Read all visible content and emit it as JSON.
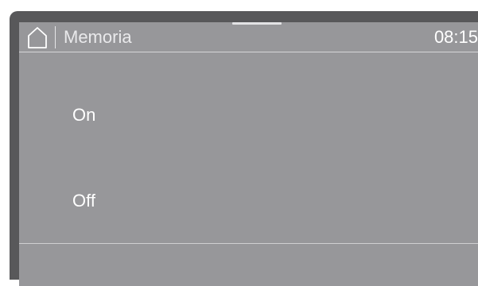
{
  "header": {
    "title": "Memoria",
    "clock": "08:15",
    "home_icon": "home-icon"
  },
  "options": [
    {
      "label": "On"
    },
    {
      "label": "Off"
    }
  ],
  "colors": {
    "bezel": "#58585a",
    "screen": "#97979a",
    "text": "#ffffff"
  }
}
